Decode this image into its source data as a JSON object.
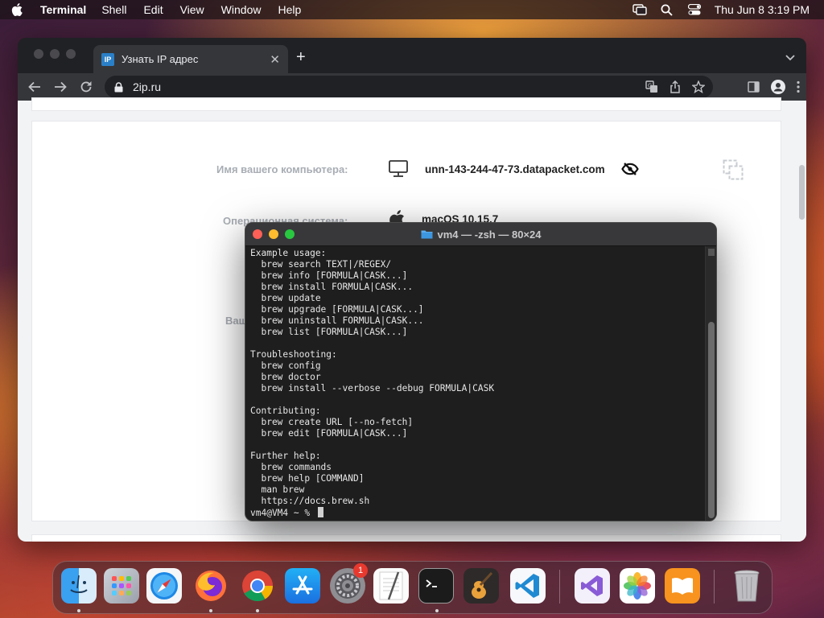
{
  "menubar": {
    "app_name": "Terminal",
    "menus": [
      "Shell",
      "Edit",
      "View",
      "Window",
      "Help"
    ],
    "clock": "Thu Jun 8  3:19 PM"
  },
  "browser": {
    "tab": {
      "favicon_text": "IP",
      "title": "Узнать IP адрес"
    },
    "address": "2ip.ru"
  },
  "page": {
    "rows": [
      {
        "label": "Имя вашего компьютера:",
        "value": "unn-143-244-47-73.datapacket.com"
      },
      {
        "label": "Операционная система:",
        "value": "macOS 10.15.7"
      },
      {
        "label": "Ваш",
        "value": ""
      }
    ]
  },
  "terminal": {
    "title": "vm4 — -zsh — 80×24",
    "lines": [
      "Example usage:",
      "  brew search TEXT|/REGEX/",
      "  brew info [FORMULA|CASK...]",
      "  brew install FORMULA|CASK...",
      "  brew update",
      "  brew upgrade [FORMULA|CASK...]",
      "  brew uninstall FORMULA|CASK...",
      "  brew list [FORMULA|CASK...]",
      "",
      "Troubleshooting:",
      "  brew config",
      "  brew doctor",
      "  brew install --verbose --debug FORMULA|CASK",
      "",
      "Contributing:",
      "  brew create URL [--no-fetch]",
      "  brew edit [FORMULA|CASK...]",
      "",
      "Further help:",
      "  brew commands",
      "  brew help [COMMAND]",
      "  man brew",
      "  https://docs.brew.sh"
    ],
    "prompt": "vm4@VM4 ~ % "
  },
  "dock": {
    "settings_badge": "1",
    "apps": [
      "finder-icon",
      "launchpad-icon",
      "safari-icon",
      "firefox-icon",
      "chrome-icon",
      "app-store-icon",
      "system-settings-icon",
      "textedit-icon",
      "terminal-icon",
      "garageband-icon",
      "vscode-icon",
      "visual-studio-icon",
      "photos-icon",
      "books-icon",
      "trash-icon"
    ]
  },
  "colors": {
    "terminal_bg": "#1e1e1e",
    "browser_chrome": "#35363a",
    "tl_red": "#fe5f57",
    "tl_yellow": "#febc2e",
    "tl_green": "#28c840"
  }
}
